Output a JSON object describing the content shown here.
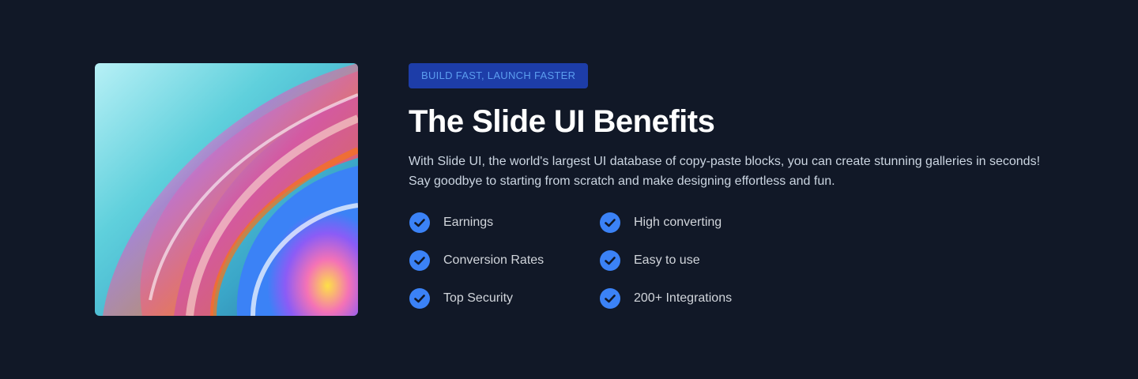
{
  "badge": "BUILD FAST, LAUNCH FASTER",
  "title": "The Slide UI Benefits",
  "description": "With Slide UI, the world's largest UI database of copy-paste blocks, you can create stunning galleries in seconds! Say goodbye to starting from scratch and make designing effortless and fun.",
  "features": [
    {
      "label": "Earnings",
      "icon": "check-circle-icon"
    },
    {
      "label": "High converting",
      "icon": "check-circle-icon"
    },
    {
      "label": "Conversion Rates",
      "icon": "check-circle-icon"
    },
    {
      "label": "Easy to use",
      "icon": "check-circle-icon"
    },
    {
      "label": "Top Security",
      "icon": "check-circle-icon"
    },
    {
      "label": "200+ Integrations",
      "icon": "check-circle-icon"
    }
  ],
  "colors": {
    "background": "#111827",
    "accent": "#3b82f6",
    "badge_bg": "#1e40af",
    "badge_text": "#60a5fa"
  }
}
